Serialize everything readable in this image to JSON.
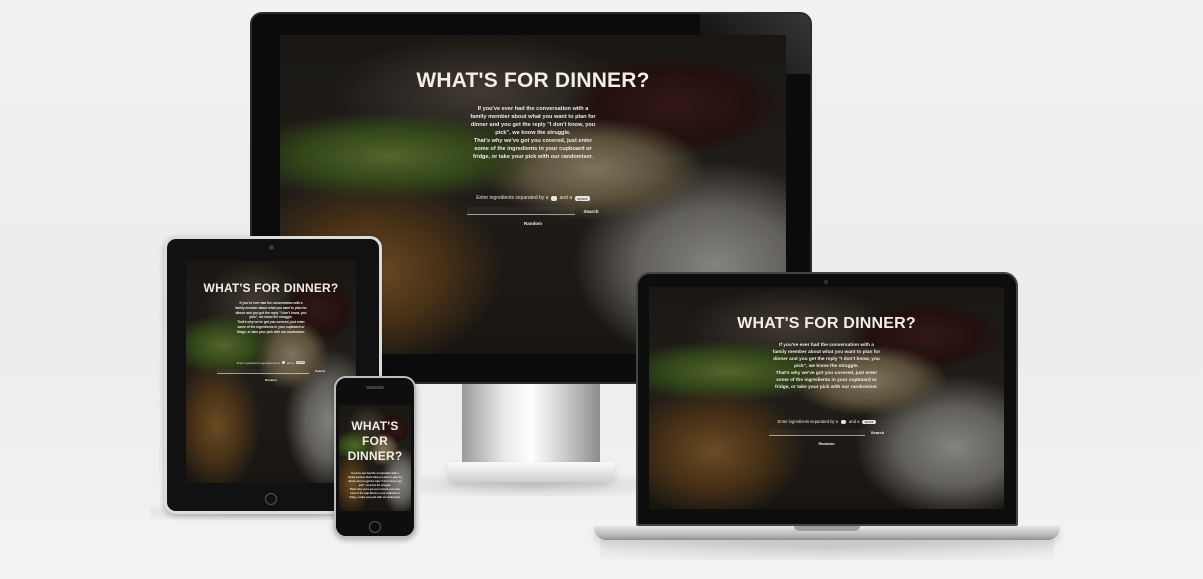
{
  "site": {
    "title": "WHAT'S FOR DINNER?",
    "phone_title_lines": [
      "WHAT'S",
      "FOR",
      "DINNER?"
    ],
    "intro_lines": [
      "If you've ever had the conversation with a",
      "family member about what you want to plan for",
      "dinner and you get the reply \"I don't know, you",
      "pick\", we know the struggle.",
      "That's why we've got you covered, just enter",
      "some of the ingredients in your cupboard or",
      "fridge, or take your pick with our randomiser."
    ],
    "ingredients_label": "Enter ingredients separated by a",
    "ingredients_and_a": "and a",
    "chip_comma": ",",
    "chip_space": "space",
    "search_button": "Search",
    "random_button": "Random"
  },
  "colors": {
    "background": "#efefef",
    "overlay_text": "#f3ede2"
  }
}
